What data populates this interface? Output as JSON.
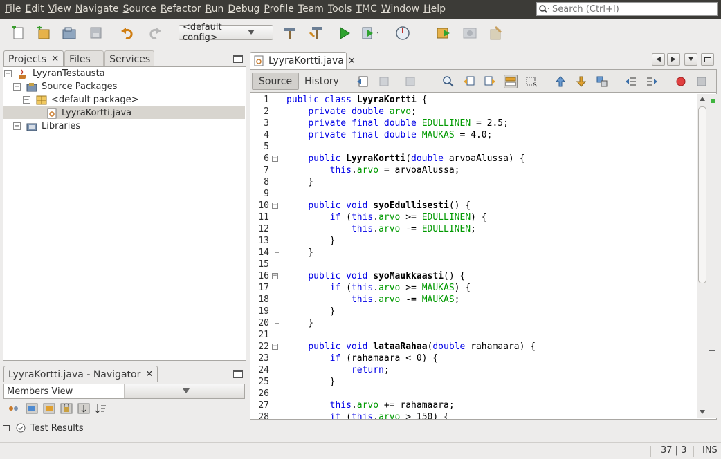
{
  "menubar": {
    "items": [
      "File",
      "Edit",
      "View",
      "Navigate",
      "Source",
      "Refactor",
      "Run",
      "Debug",
      "Profile",
      "Team",
      "Tools",
      "TMC",
      "Window",
      "Help"
    ],
    "search_placeholder": "Search (Ctrl+I)"
  },
  "toolbar": {
    "config_value": "<default config>"
  },
  "projects_panel": {
    "tabs": [
      "Projects",
      "Files",
      "Services"
    ],
    "tree": {
      "project": "LyyranTestausta",
      "source_packages": "Source Packages",
      "default_package": "<default package>",
      "file": "LyyraKortti.java",
      "libraries": "Libraries"
    }
  },
  "navigator_panel": {
    "title": "LyyraKortti.java - Navigator",
    "view_mode": "Members View"
  },
  "editor": {
    "tab_title": "LyyraKortti.java",
    "source_tab": "Source",
    "history_tab": "History",
    "lines": [
      {
        "n": "1",
        "code": "public class LyyraKortti {"
      },
      {
        "n": "2",
        "code": "    private double arvo;"
      },
      {
        "n": "3",
        "code": "    private final double EDULLINEN = 2.5;"
      },
      {
        "n": "4",
        "code": "    private final double MAUKAS = 4.0;"
      },
      {
        "n": "5",
        "code": ""
      },
      {
        "n": "6",
        "code": "    public LyyraKortti(double arvoaAlussa) {"
      },
      {
        "n": "7",
        "code": "        this.arvo = arvoaAlussa;"
      },
      {
        "n": "8",
        "code": "    }"
      },
      {
        "n": "9",
        "code": ""
      },
      {
        "n": "10",
        "code": "    public void syoEdullisesti() {"
      },
      {
        "n": "11",
        "code": "        if (this.arvo >= EDULLINEN) {"
      },
      {
        "n": "12",
        "code": "            this.arvo -= EDULLINEN;"
      },
      {
        "n": "13",
        "code": "        }"
      },
      {
        "n": "14",
        "code": "    }"
      },
      {
        "n": "15",
        "code": ""
      },
      {
        "n": "16",
        "code": "    public void syoMaukkaasti() {"
      },
      {
        "n": "17",
        "code": "        if (this.arvo >= MAUKAS) {"
      },
      {
        "n": "18",
        "code": "            this.arvo -= MAUKAS;"
      },
      {
        "n": "19",
        "code": "        }"
      },
      {
        "n": "20",
        "code": "    }"
      },
      {
        "n": "21",
        "code": ""
      },
      {
        "n": "22",
        "code": "    public void lataaRahaa(double rahamaara) {"
      },
      {
        "n": "23",
        "code": "        if (rahamaara < 0) {"
      },
      {
        "n": "24",
        "code": "            return;"
      },
      {
        "n": "25",
        "code": "        }"
      },
      {
        "n": "26",
        "code": ""
      },
      {
        "n": "27",
        "code": "        this.arvo += rahamaara;"
      },
      {
        "n": "28",
        "code": "        if (this.arvo > 150) {"
      }
    ]
  },
  "bottom": {
    "test_results": "Test Results"
  },
  "statusbar": {
    "position": "37 | 3",
    "mode": "INS"
  },
  "colors": {
    "keyword": "#0000e6",
    "field": "#009900",
    "menubar_bg": "#3c3b37"
  }
}
